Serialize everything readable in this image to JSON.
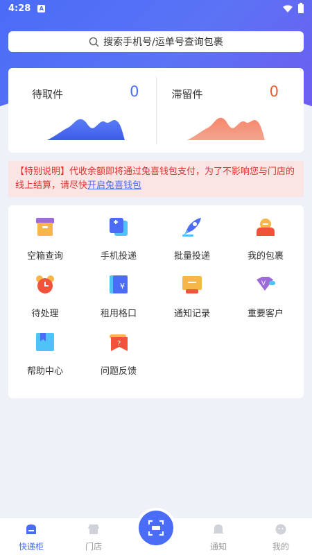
{
  "status_bar": {
    "time": "4:28"
  },
  "search": {
    "placeholder": "搜索手机号/运单号查询包裹"
  },
  "summary": {
    "pending": {
      "label": "待取件",
      "count": "0"
    },
    "overdue": {
      "label": "滞留件",
      "count": "0"
    }
  },
  "notice": {
    "text": "【特别说明】代收余额即将通过兔喜钱包支付，为了不影响您与门店的线上结算，请尽快",
    "link": "开启兔喜钱包"
  },
  "grid": [
    {
      "label": "空箱查询",
      "icon": "empty-box-icon"
    },
    {
      "label": "手机投递",
      "icon": "phone-delivery-icon"
    },
    {
      "label": "批量投递",
      "icon": "rocket-icon"
    },
    {
      "label": "我的包裹",
      "icon": "my-parcel-icon"
    },
    {
      "label": "待处理",
      "icon": "alarm-clock-icon"
    },
    {
      "label": "租用格口",
      "icon": "rent-locker-icon"
    },
    {
      "label": "通知记录",
      "icon": "notice-record-icon"
    },
    {
      "label": "重要客户",
      "icon": "vip-customer-icon"
    },
    {
      "label": "帮助中心",
      "icon": "help-book-icon"
    },
    {
      "label": "问题反馈",
      "icon": "feedback-icon"
    }
  ],
  "tabs": [
    {
      "label": "快递柜",
      "icon": "locker-icon",
      "active": true
    },
    {
      "label": "门店",
      "icon": "store-icon"
    },
    {
      "label": "通知",
      "icon": "bell-icon"
    },
    {
      "label": "我的",
      "icon": "profile-icon"
    }
  ],
  "colors": {
    "primary": "#4a6cf7",
    "alert": "#e0322c",
    "overdue": "#f05a28"
  }
}
